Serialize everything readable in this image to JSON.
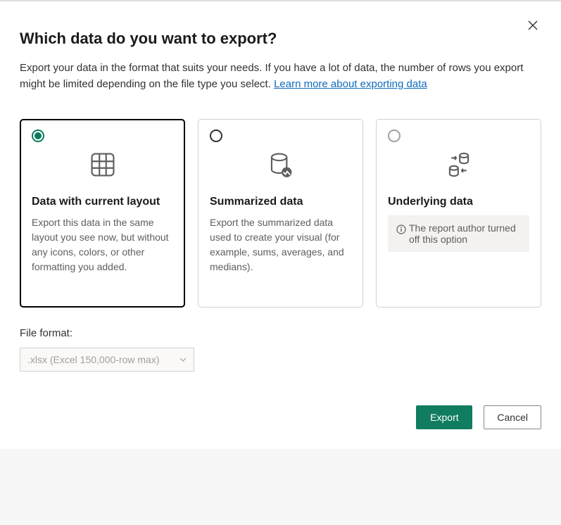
{
  "header": {
    "title": "Which data do you want to export?",
    "intro": "Export your data in the format that suits your needs. If you have a lot of data, the number of rows you export might be limited depending on the file type you select.  ",
    "learn_more": "Learn more about exporting data"
  },
  "options": [
    {
      "title": "Data with current layout",
      "desc": "Export this data in the same layout you see now, but without any icons, colors, or other formatting you added.",
      "selected": true,
      "disabled": false
    },
    {
      "title": "Summarized data",
      "desc": "Export the summarized data used to create your visual (for example, sums, averages, and medians).",
      "selected": false,
      "disabled": false
    },
    {
      "title": "Underlying data",
      "desc": "",
      "info": "The report author turned off this option",
      "selected": false,
      "disabled": true
    }
  ],
  "file_format": {
    "label": "File format:",
    "value": ".xlsx (Excel 150,000-row max)"
  },
  "buttons": {
    "export": "Export",
    "cancel": "Cancel"
  }
}
